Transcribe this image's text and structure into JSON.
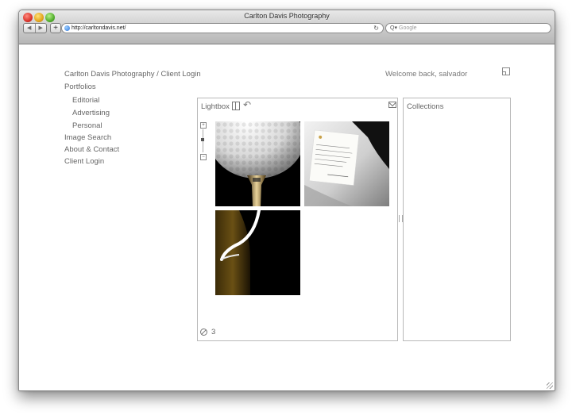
{
  "browser": {
    "window_title": "Carlton Davis Photography",
    "back_label": "◀",
    "forward_label": "▶",
    "add_label": "+",
    "url": "http://carltondavis.net/",
    "reload_icon": "reload-icon",
    "search_placeholder": "Google",
    "search_glyph": "Q▾"
  },
  "site": {
    "title": "Carlton Davis Photography / Client Login",
    "welcome": "Welcome back, salvador"
  },
  "nav": {
    "portfolios": "Portfolios",
    "editorial": "Editorial",
    "advertising": "Advertising",
    "personal": "Personal",
    "image_search": "Image Search",
    "about_contact": "About & Contact",
    "client_login": "Client Login"
  },
  "lightbox": {
    "title": "Lightbox",
    "undo_glyph": "↶",
    "zoom_plus": "+",
    "zoom_minus": "−",
    "count": "3"
  },
  "collections": {
    "title": "Collections"
  },
  "colors": {
    "text": "#666666",
    "border": "#b9b9b9",
    "photo_dark": "#000000"
  }
}
